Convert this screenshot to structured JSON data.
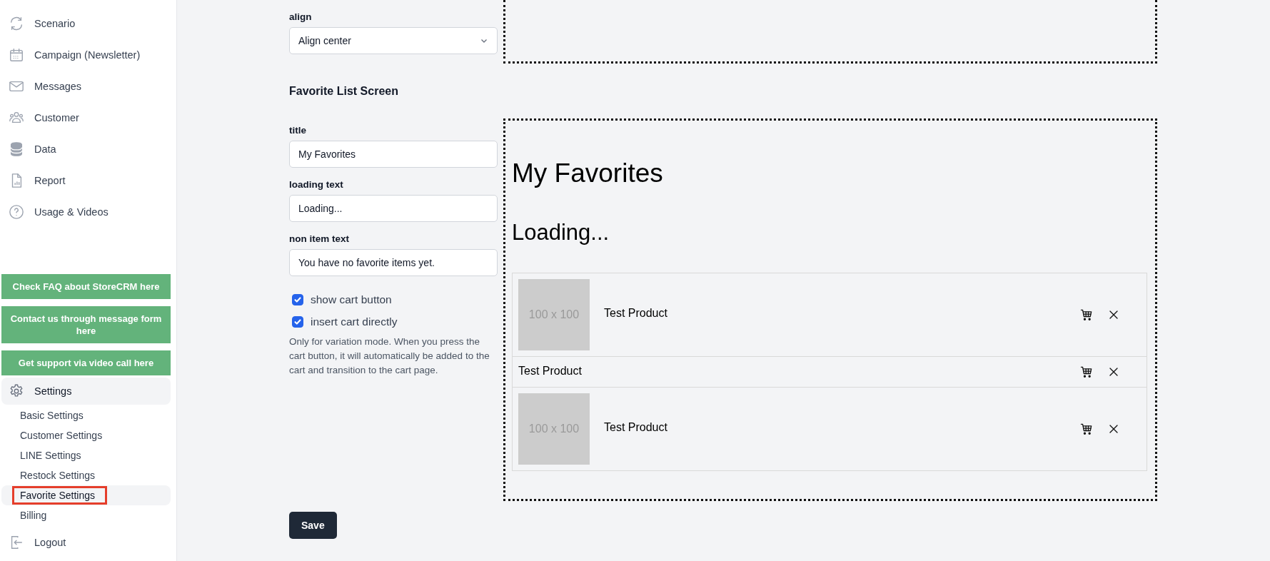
{
  "sidebar": {
    "nav_items": [
      {
        "label": "Scenario"
      },
      {
        "label": "Campaign (Newsletter)"
      },
      {
        "label": "Messages"
      },
      {
        "label": "Customer"
      },
      {
        "label": "Data"
      },
      {
        "label": "Report"
      },
      {
        "label": "Usage & Videos"
      }
    ],
    "help_buttons": [
      "Check FAQ about StoreCRM here",
      "Contact us through message form here",
      "Get support via video call here"
    ],
    "settings": {
      "label": "Settings",
      "sub_items": [
        {
          "label": "Basic Settings",
          "selected": false
        },
        {
          "label": "Customer Settings",
          "selected": false
        },
        {
          "label": "LINE Settings",
          "selected": false
        },
        {
          "label": "Restock Settings",
          "selected": false
        },
        {
          "label": "Favorite Settings",
          "selected": true
        },
        {
          "label": "Billing",
          "selected": false
        }
      ]
    },
    "logout": "Logout"
  },
  "align_field": {
    "label": "align",
    "value": "Align center"
  },
  "favorite_list_screen": {
    "heading": "Favorite List Screen",
    "fields": [
      {
        "label": "title",
        "value": "My Favorites"
      },
      {
        "label": "loading text",
        "value": "Loading..."
      },
      {
        "label": "non item text",
        "value": "You have no favorite items yet."
      }
    ],
    "checkboxes": [
      {
        "label": "show cart button",
        "checked": true
      },
      {
        "label": "insert cart directly",
        "checked": true
      }
    ],
    "help_text": "Only for variation mode. When you press the cart button, it will automatically be added to the cart and transition to the cart page."
  },
  "preview": {
    "title": "My Favorites",
    "loading": "Loading...",
    "items": [
      {
        "kind": "with-image",
        "image_text": "100 x 100",
        "name": "Test Product"
      },
      {
        "kind": "text-only",
        "name": "Test Product"
      },
      {
        "kind": "with-image",
        "image_text": "100 x 100",
        "name": "Test Product"
      }
    ]
  },
  "save_button": "Save"
}
